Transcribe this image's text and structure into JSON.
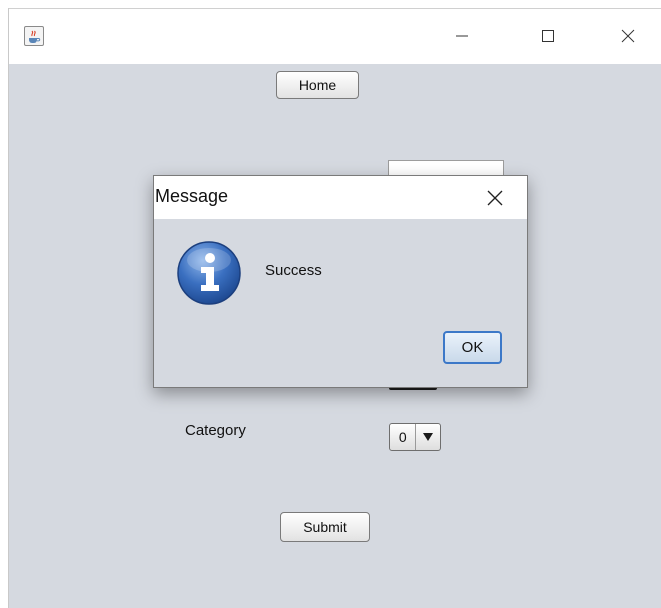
{
  "window": {
    "app_icon": "java-cup-icon",
    "controls": {
      "minimize_icon": "minimize-icon",
      "maximize_icon": "maximize-icon",
      "close_icon": "close-icon"
    }
  },
  "form": {
    "home_label": "Home",
    "category_label": "Category",
    "category_value": "0",
    "submit_label": "Submit"
  },
  "dialog": {
    "title": "Message",
    "message": "Success",
    "ok_label": "OK",
    "icon": "information-icon"
  },
  "colors": {
    "window_bg": "#d5d9e0",
    "titlebar_bg": "#ffffff",
    "info_blue": "#3a6fc0",
    "ok_focus_border": "#3c78c8"
  }
}
